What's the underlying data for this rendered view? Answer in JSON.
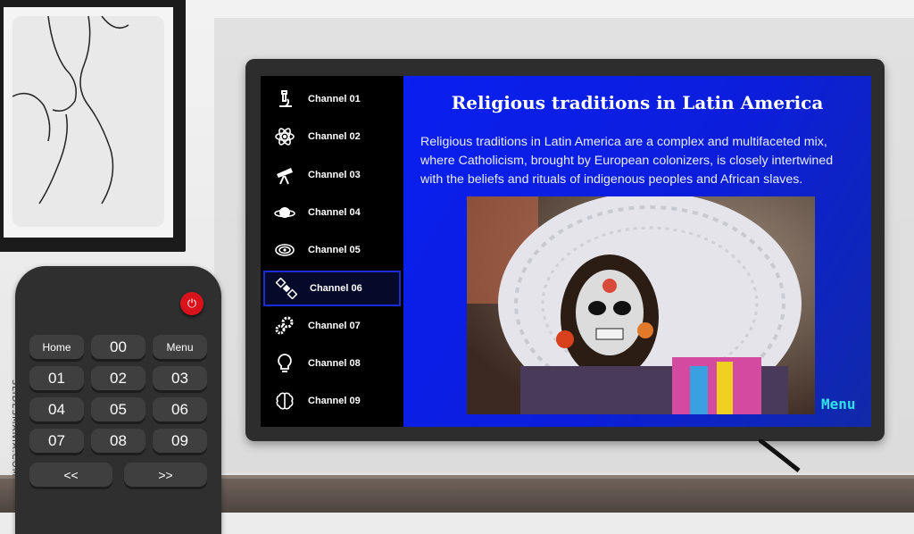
{
  "channels": [
    {
      "label": "Channel 01",
      "icon": "microscope-icon"
    },
    {
      "label": "Channel 02",
      "icon": "atom-icon"
    },
    {
      "label": "Channel 03",
      "icon": "telescope-icon"
    },
    {
      "label": "Channel 04",
      "icon": "planet-icon"
    },
    {
      "label": "Channel 05",
      "icon": "galaxy-icon"
    },
    {
      "label": "Channel 06",
      "icon": "satellite-icon",
      "active": true
    },
    {
      "label": "Channel 07",
      "icon": "gears-icon"
    },
    {
      "label": "Channel 08",
      "icon": "lightbulb-icon"
    },
    {
      "label": "Channel 09",
      "icon": "brain-icon"
    }
  ],
  "panel": {
    "title": "Religious traditions in Latin America",
    "body": "Religious traditions in Latin America are a complex and multifaceted mix, where Catholicism, brought by European colonizers, is closely intertwined with the beliefs and rituals of indigenous peoples and African slaves.",
    "menu": "Menu"
  },
  "credit": "SLIDESMANIA.COM",
  "remote": {
    "home": "Home",
    "zero": "00",
    "menu": "Menu",
    "digits": [
      "01",
      "02",
      "03",
      "04",
      "05",
      "06",
      "07",
      "08",
      "09"
    ],
    "prev": "<<",
    "next": ">>"
  },
  "colors": {
    "panel": "#0a1ff0",
    "menu_accent": "#2fe2ea",
    "power": "#d8131b",
    "active_border": "#1c2bd8"
  }
}
